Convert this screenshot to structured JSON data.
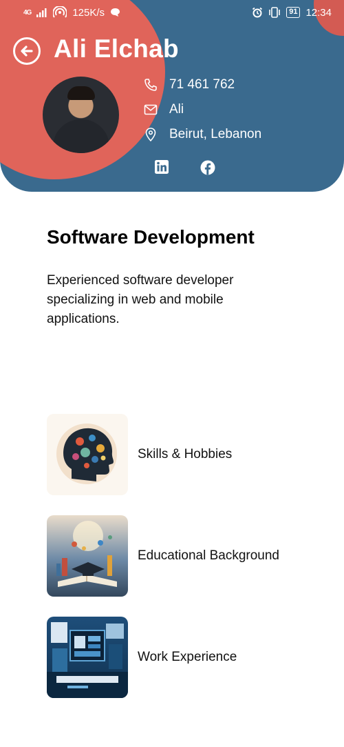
{
  "status_bar": {
    "network_small": "4G",
    "speed": "125K/s",
    "battery": "91",
    "time": "12:34"
  },
  "header": {
    "name": "Ali Elchab",
    "contacts": [
      {
        "icon": "phone-icon",
        "text": "71 461 762"
      },
      {
        "icon": "mail-icon",
        "text": "Ali"
      },
      {
        "icon": "location-pin-icon",
        "text": "Beirut, Lebanon"
      }
    ],
    "social": [
      "linkedin-icon",
      "facebook-icon"
    ]
  },
  "section": {
    "title": "Software Development",
    "description": "Experienced software developer specializing in web and mobile applications."
  },
  "items": [
    {
      "label": "Skills & Hobbies"
    },
    {
      "label": "Educational Background"
    },
    {
      "label": "Work Experience"
    }
  ],
  "colors": {
    "header_blue": "#3a6a8e",
    "blob_coral": "#e0645a"
  }
}
